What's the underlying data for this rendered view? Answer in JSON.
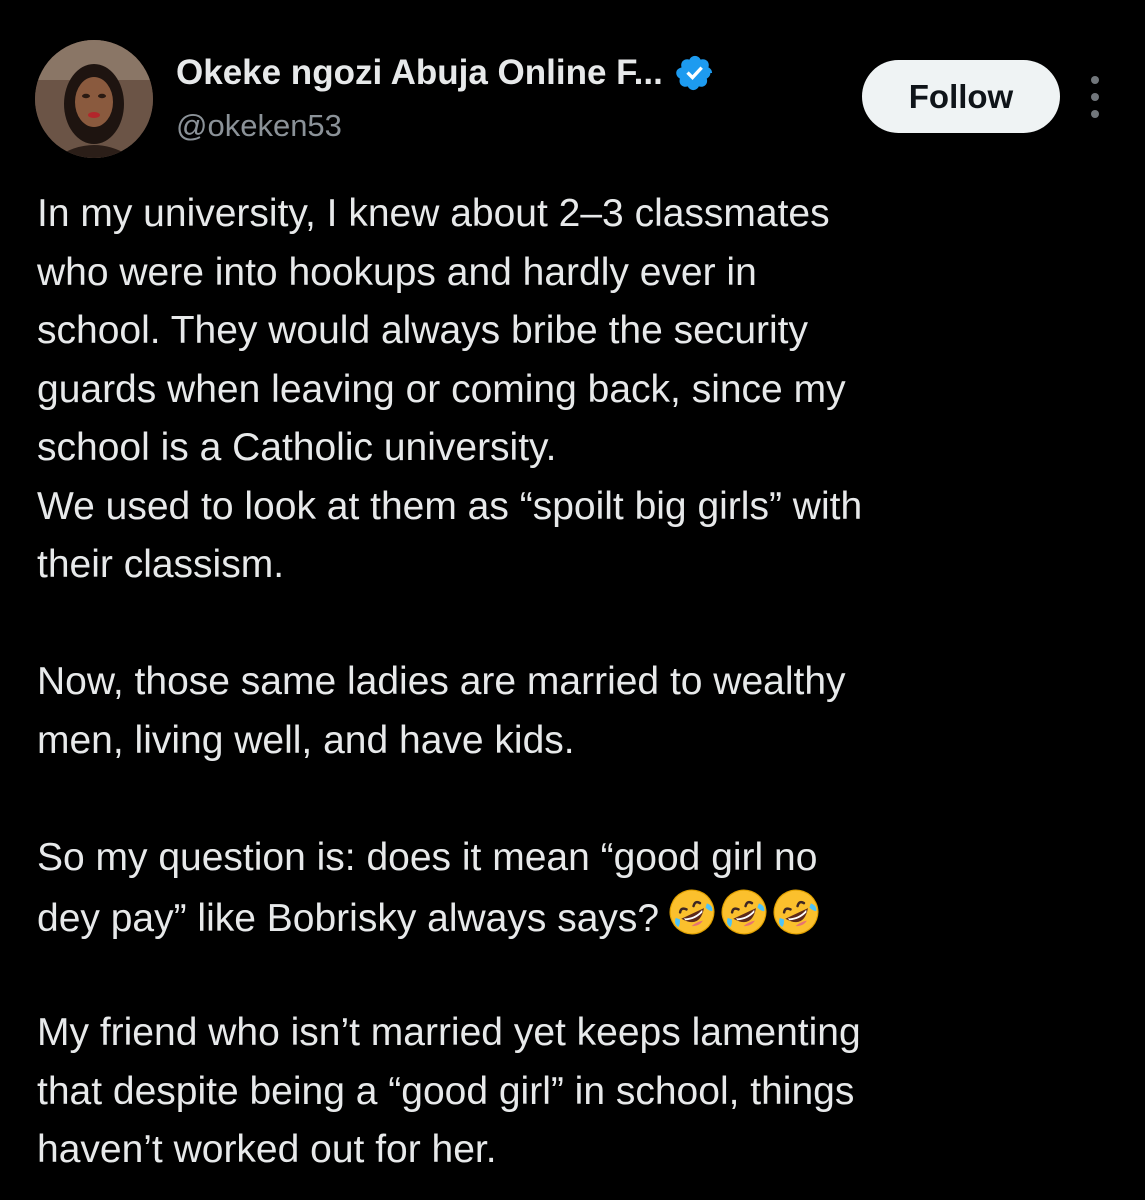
{
  "author": {
    "display_name": "Okeke ngozi Abuja Online F...",
    "handle": "@okeken53",
    "verified": true,
    "avatar_icon": "profile-photo",
    "verified_icon": "verified-badge-icon",
    "verified_color": "#1d9bf0"
  },
  "actions": {
    "follow_label": "Follow",
    "more_icon": "more-options-icon"
  },
  "tweet": {
    "lines": [
      "In my university, I knew about 2–3 classmates",
      "who were into hookups and hardly ever in",
      "school. They would always bribe the security",
      "guards when leaving or coming back, since my",
      "school is a Catholic university.",
      "We used to look at them as “spoilt big girls” with",
      "their classism.",
      "",
      "Now, those same ladies are married to wealthy",
      "men, living well, and have kids.",
      "",
      "So my question is: does it mean “good girl no",
      "dey pay” like Bobrisky always says?",
      "",
      "My friend who isn’t married yet keeps lamenting",
      "that despite being a “good girl” in school, things",
      "haven’t worked out for her."
    ],
    "emoji_after_line": 12,
    "emoji": [
      "rolling-on-floor-laughing-emoji",
      "rolling-on-floor-laughing-emoji",
      "rolling-on-floor-laughing-emoji"
    ]
  },
  "colors": {
    "background": "#000000",
    "text_primary": "#e7e9ea",
    "text_secondary": "#8b9298",
    "follow_bg": "#eff3f4",
    "follow_text": "#0f1419"
  }
}
